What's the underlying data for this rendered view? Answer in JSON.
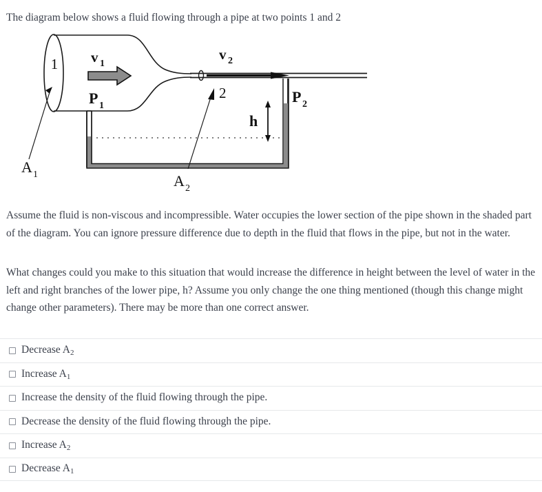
{
  "prompt": "The diagram below shows a fluid flowing through a pipe at two points 1 and 2",
  "figure": {
    "labels": {
      "point_1": "1",
      "point_2": "2",
      "v1": "v",
      "v1_sub": "1",
      "v2": "v",
      "v2_sub": "2",
      "p1": "P",
      "p1_sub": "1",
      "p2": "P",
      "p2_sub": "2",
      "a1": "A",
      "a1_sub": "1",
      "a2": "A",
      "a2_sub": "2",
      "h": "h"
    },
    "colors": {
      "outline": "#1a1a1a",
      "water_fill": "#8c8c8c",
      "arrow_fill": "#8c8c8c",
      "dotted_level": "#555555"
    }
  },
  "paragraphs": [
    "Assume the fluid is non-viscous and incompressible.  Water occupies the lower section of the pipe shown in the shaded part of the diagram.  You can ignore pressure difference due to depth in the fluid that flows in the pipe, but not in the water.",
    "What changes could you make to this situation that would increase the difference in height between the level of water in the left and right branches of the lower pipe, h?  Assume you only change the one thing mentioned (though this change might change other parameters).  There may be more than one correct answer."
  ],
  "options": [
    {
      "text": "Decrease A",
      "sub": "2",
      "tail": "",
      "checked": false
    },
    {
      "text": "Increase A",
      "sub": "1",
      "tail": "",
      "checked": false
    },
    {
      "text": "Increase the density of the fluid flowing through the pipe.",
      "sub": "",
      "tail": "",
      "checked": false
    },
    {
      "text": "Decrease the density of the fluid flowing through the pipe.",
      "sub": "",
      "tail": "",
      "checked": false
    },
    {
      "text": "Increase A",
      "sub": "2",
      "tail": "",
      "checked": false
    },
    {
      "text": "Decrease A",
      "sub": "1",
      "tail": "",
      "checked": false
    }
  ]
}
